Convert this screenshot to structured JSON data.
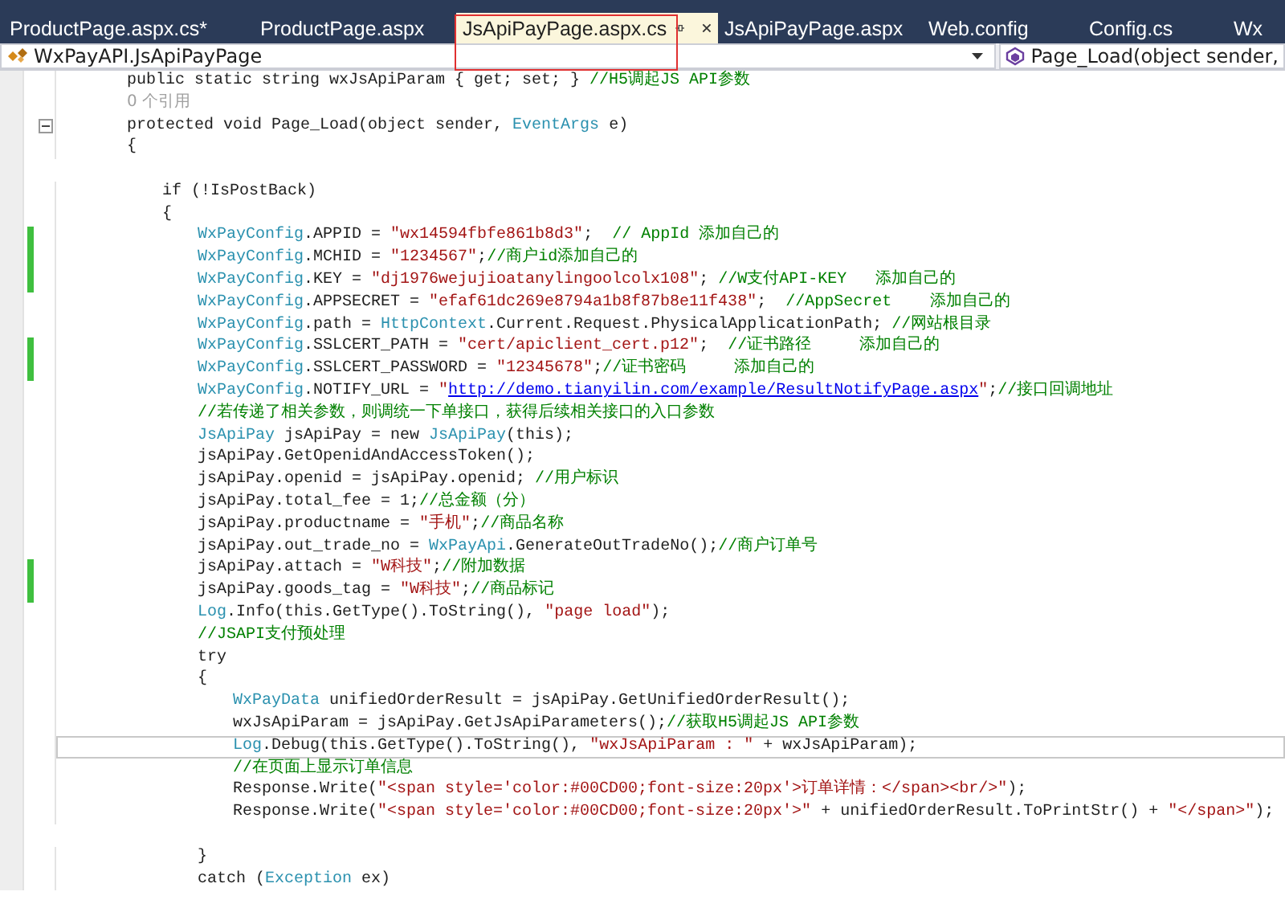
{
  "tabs": [
    {
      "label": "ProductPage.aspx.cs*",
      "selected": false
    },
    {
      "label": "ProductPage.aspx",
      "selected": false
    },
    {
      "label": "JsApiPayPage.aspx.cs",
      "selected": true
    },
    {
      "label": "JsApiPayPage.aspx",
      "selected": false
    },
    {
      "label": "Web.config",
      "selected": false
    },
    {
      "label": "Config.cs",
      "selected": false
    },
    {
      "label": "Wx",
      "selected": false
    }
  ],
  "navigation": {
    "class": "WxPayAPI.JsApiPayPage",
    "member": "Page_Load(object sender,"
  },
  "editor": {
    "lines": [
      {
        "collapsible": false,
        "tokens": [
          {
            "kind": "plain",
            "text": "public static string wxJsApiParam { get; set; } "
          },
          {
            "kind": "comment",
            "text": "//H5调起JS API参数"
          }
        ]
      },
      {
        "collapsible": false,
        "tokens": [
          {
            "kind": "hint",
            "text": "0 个引用"
          }
        ]
      },
      {
        "collapsible": true,
        "tokens": [
          {
            "kind": "plain",
            "text": "protected void Page_Load(object sender, "
          },
          {
            "kind": "type",
            "text": "EventArgs"
          },
          {
            "kind": "plain",
            "text": " e)"
          }
        ]
      },
      {
        "collapsible": false,
        "tokens": [
          {
            "kind": "plain",
            "text": "{"
          }
        ],
        "children": [
          {
            "space_before": true,
            "tokens": [
              {
                "kind": "plain",
                "text": "if (!IsPostBack)"
              }
            ]
          },
          {
            "space_before": false,
            "tokens": [
              {
                "kind": "plain",
                "text": "{"
              }
            ],
            "children": [
              {
                "changed": true,
                "tokens": [
                  {
                    "kind": "type",
                    "text": "WxPayConfig"
                  },
                  {
                    "kind": "plain",
                    "text": ".APPID = "
                  },
                  {
                    "kind": "string",
                    "text": "\"wx14594fbfe861b8d3\""
                  },
                  {
                    "kind": "plain",
                    "text": ";  "
                  },
                  {
                    "kind": "comment",
                    "text": "// AppId 添加自己的"
                  }
                ]
              },
              {
                "changed": true,
                "tokens": [
                  {
                    "kind": "type",
                    "text": "WxPayConfig"
                  },
                  {
                    "kind": "plain",
                    "text": ".MCHID = "
                  },
                  {
                    "kind": "string",
                    "text": "\"1234567\""
                  },
                  {
                    "kind": "plain",
                    "text": ";"
                  },
                  {
                    "kind": "comment",
                    "text": "//商户id添加自己的"
                  }
                ]
              },
              {
                "changed": true,
                "tokens": [
                  {
                    "kind": "type",
                    "text": "WxPayConfig"
                  },
                  {
                    "kind": "plain",
                    "text": ".KEY = "
                  },
                  {
                    "kind": "string",
                    "text": "\"dj1976wejujioatanylingoolcolx108\""
                  },
                  {
                    "kind": "plain",
                    "text": "; "
                  },
                  {
                    "kind": "comment",
                    "text": "//W支付API-KEY   添加自己的"
                  }
                ]
              },
              {
                "changed": false,
                "tokens": [
                  {
                    "kind": "type",
                    "text": "WxPayConfig"
                  },
                  {
                    "kind": "plain",
                    "text": ".APPSECRET = "
                  },
                  {
                    "kind": "string",
                    "text": "\"efaf61dc269e8794a1b8f87b8e11f438\""
                  },
                  {
                    "kind": "plain",
                    "text": ";  "
                  },
                  {
                    "kind": "comment",
                    "text": "//AppSecret    添加自己的"
                  }
                ]
              },
              {
                "changed": false,
                "tokens": [
                  {
                    "kind": "type",
                    "text": "WxPayConfig"
                  },
                  {
                    "kind": "plain",
                    "text": ".path = "
                  },
                  {
                    "kind": "type",
                    "text": "HttpContext"
                  },
                  {
                    "kind": "plain",
                    "text": ".Current.Request.PhysicalApplicationPath; "
                  },
                  {
                    "kind": "comment",
                    "text": "//网站根目录"
                  }
                ]
              },
              {
                "changed": true,
                "tokens": [
                  {
                    "kind": "type",
                    "text": "WxPayConfig"
                  },
                  {
                    "kind": "plain",
                    "text": ".SSLCERT_PATH = "
                  },
                  {
                    "kind": "string",
                    "text": "\"cert/apiclient_cert.p12\""
                  },
                  {
                    "kind": "plain",
                    "text": ";  "
                  },
                  {
                    "kind": "comment",
                    "text": "//证书路径     添加自己的"
                  }
                ]
              },
              {
                "changed": true,
                "tokens": [
                  {
                    "kind": "type",
                    "text": "WxPayConfig"
                  },
                  {
                    "kind": "plain",
                    "text": ".SSLCERT_PASSWORD = "
                  },
                  {
                    "kind": "string",
                    "text": "\"12345678\""
                  },
                  {
                    "kind": "plain",
                    "text": ";"
                  },
                  {
                    "kind": "comment",
                    "text": "//证书密码     添加自己的"
                  }
                ]
              },
              {
                "changed": false,
                "tokens": [
                  {
                    "kind": "type",
                    "text": "WxPayConfig"
                  },
                  {
                    "kind": "plain",
                    "text": ".NOTIFY_URL = "
                  },
                  {
                    "kind": "string",
                    "text": "\""
                  },
                  {
                    "kind": "link",
                    "text": "http://demo.tianyilin.com/example/ResultNotifyPage.aspx"
                  },
                  {
                    "kind": "string",
                    "text": "\""
                  },
                  {
                    "kind": "plain",
                    "text": ";"
                  },
                  {
                    "kind": "comment",
                    "text": "//接口回调地址"
                  }
                ]
              },
              {
                "changed": false,
                "tokens": [
                  {
                    "kind": "comment",
                    "text": "//若传递了相关参数，则调统一下单接口，获得后续相关接口的入口参数"
                  }
                ]
              },
              {
                "changed": false,
                "tokens": [
                  {
                    "kind": "type",
                    "text": "JsApiPay"
                  },
                  {
                    "kind": "plain",
                    "text": " jsApiPay = new "
                  },
                  {
                    "kind": "type",
                    "text": "JsApiPay"
                  },
                  {
                    "kind": "plain",
                    "text": "(this);"
                  }
                ]
              },
              {
                "changed": false,
                "tokens": [
                  {
                    "kind": "plain",
                    "text": "jsApiPay.GetOpenidAndAccessToken();"
                  }
                ]
              },
              {
                "changed": false,
                "tokens": [
                  {
                    "kind": "plain",
                    "text": "jsApiPay.openid = jsApiPay.openid; "
                  },
                  {
                    "kind": "comment",
                    "text": "//用户标识"
                  }
                ]
              },
              {
                "changed": false,
                "tokens": [
                  {
                    "kind": "plain",
                    "text": "jsApiPay.total_fee = 1;"
                  },
                  {
                    "kind": "comment",
                    "text": "//总金额（分）"
                  }
                ]
              },
              {
                "changed": false,
                "tokens": [
                  {
                    "kind": "plain",
                    "text": "jsApiPay.productname = "
                  },
                  {
                    "kind": "string",
                    "text": "\"手机\""
                  },
                  {
                    "kind": "plain",
                    "text": ";"
                  },
                  {
                    "kind": "comment",
                    "text": "//商品名称"
                  }
                ]
              },
              {
                "changed": false,
                "tokens": [
                  {
                    "kind": "plain",
                    "text": "jsApiPay.out_trade_no = "
                  },
                  {
                    "kind": "type",
                    "text": "WxPayApi"
                  },
                  {
                    "kind": "plain",
                    "text": ".GenerateOutTradeNo();"
                  },
                  {
                    "kind": "comment",
                    "text": "//商户订单号"
                  }
                ]
              },
              {
                "changed": true,
                "tokens": [
                  {
                    "kind": "plain",
                    "text": "jsApiPay.attach = "
                  },
                  {
                    "kind": "string",
                    "text": "\"W科技\""
                  },
                  {
                    "kind": "plain",
                    "text": ";"
                  },
                  {
                    "kind": "comment",
                    "text": "//附加数据"
                  }
                ]
              },
              {
                "changed": true,
                "tokens": [
                  {
                    "kind": "plain",
                    "text": "jsApiPay.goods_tag = "
                  },
                  {
                    "kind": "string",
                    "text": "\"W科技\""
                  },
                  {
                    "kind": "plain",
                    "text": ";"
                  },
                  {
                    "kind": "comment",
                    "text": "//商品标记"
                  }
                ]
              },
              {
                "changed": false,
                "tokens": [
                  {
                    "kind": "type",
                    "text": "Log"
                  },
                  {
                    "kind": "plain",
                    "text": ".Info(this.GetType().ToString(), "
                  },
                  {
                    "kind": "string",
                    "text": "\"page load\""
                  },
                  {
                    "kind": "plain",
                    "text": ");"
                  }
                ]
              },
              {
                "changed": false,
                "tokens": [
                  {
                    "kind": "comment",
                    "text": "//JSAPI支付预处理"
                  }
                ]
              },
              {
                "changed": false,
                "tokens": [
                  {
                    "kind": "plain",
                    "text": "try"
                  }
                ]
              },
              {
                "changed": false,
                "tokens": [
                  {
                    "kind": "plain",
                    "text": "{"
                  }
                ],
                "children": [
                  {
                    "current": false,
                    "tokens": [
                      {
                        "kind": "type",
                        "text": "WxPayData"
                      },
                      {
                        "kind": "plain",
                        "text": " unifiedOrderResult = jsApiPay.GetUnifiedOrderResult();"
                      }
                    ]
                  },
                  {
                    "current": false,
                    "tokens": [
                      {
                        "kind": "plain",
                        "text": "wxJsApiParam = jsApiPay.GetJsApiParameters();"
                      },
                      {
                        "kind": "comment",
                        "text": "//获取H5调起JS API参数"
                      }
                    ]
                  },
                  {
                    "current": true,
                    "tokens": [
                      {
                        "kind": "type",
                        "text": "Log"
                      },
                      {
                        "kind": "plain",
                        "text": ".Debug(this.GetType().ToString(), "
                      },
                      {
                        "kind": "string",
                        "text": "\"wxJsApiParam : \""
                      },
                      {
                        "kind": "plain",
                        "text": " + wxJsApiParam);"
                      }
                    ]
                  },
                  {
                    "current": false,
                    "tokens": [
                      {
                        "kind": "comment",
                        "text": "//在页面上显示订单信息"
                      }
                    ]
                  },
                  {
                    "current": false,
                    "tokens": [
                      {
                        "kind": "plain",
                        "text": "Response.Write("
                      },
                      {
                        "kind": "string",
                        "text": "\"<span style='color:#00CD00;font-size:20px'>订单详情：</span><br/>\""
                      },
                      {
                        "kind": "plain",
                        "text": ");"
                      }
                    ]
                  },
                  {
                    "current": false,
                    "tokens": [
                      {
                        "kind": "plain",
                        "text": "Response.Write("
                      },
                      {
                        "kind": "string",
                        "text": "\"<span style='color:#00CD00;font-size:20px'>\""
                      },
                      {
                        "kind": "plain",
                        "text": " + unifiedOrderResult.ToPrintStr() + "
                      },
                      {
                        "kind": "string",
                        "text": "\"</span>\""
                      },
                      {
                        "kind": "plain",
                        "text": ");"
                      }
                    ]
                  }
                ]
              },
              {
                "changed": false,
                "space_before": true,
                "tokens": [
                  {
                    "kind": "plain",
                    "text": "}"
                  }
                ]
              },
              {
                "changed": false,
                "tokens": [
                  {
                    "kind": "plain",
                    "text": "catch ("
                  },
                  {
                    "kind": "type",
                    "text": "Exception"
                  },
                  {
                    "kind": "plain",
                    "text": " ex)"
                  }
                ]
              }
            ]
          }
        ]
      }
    ]
  }
}
